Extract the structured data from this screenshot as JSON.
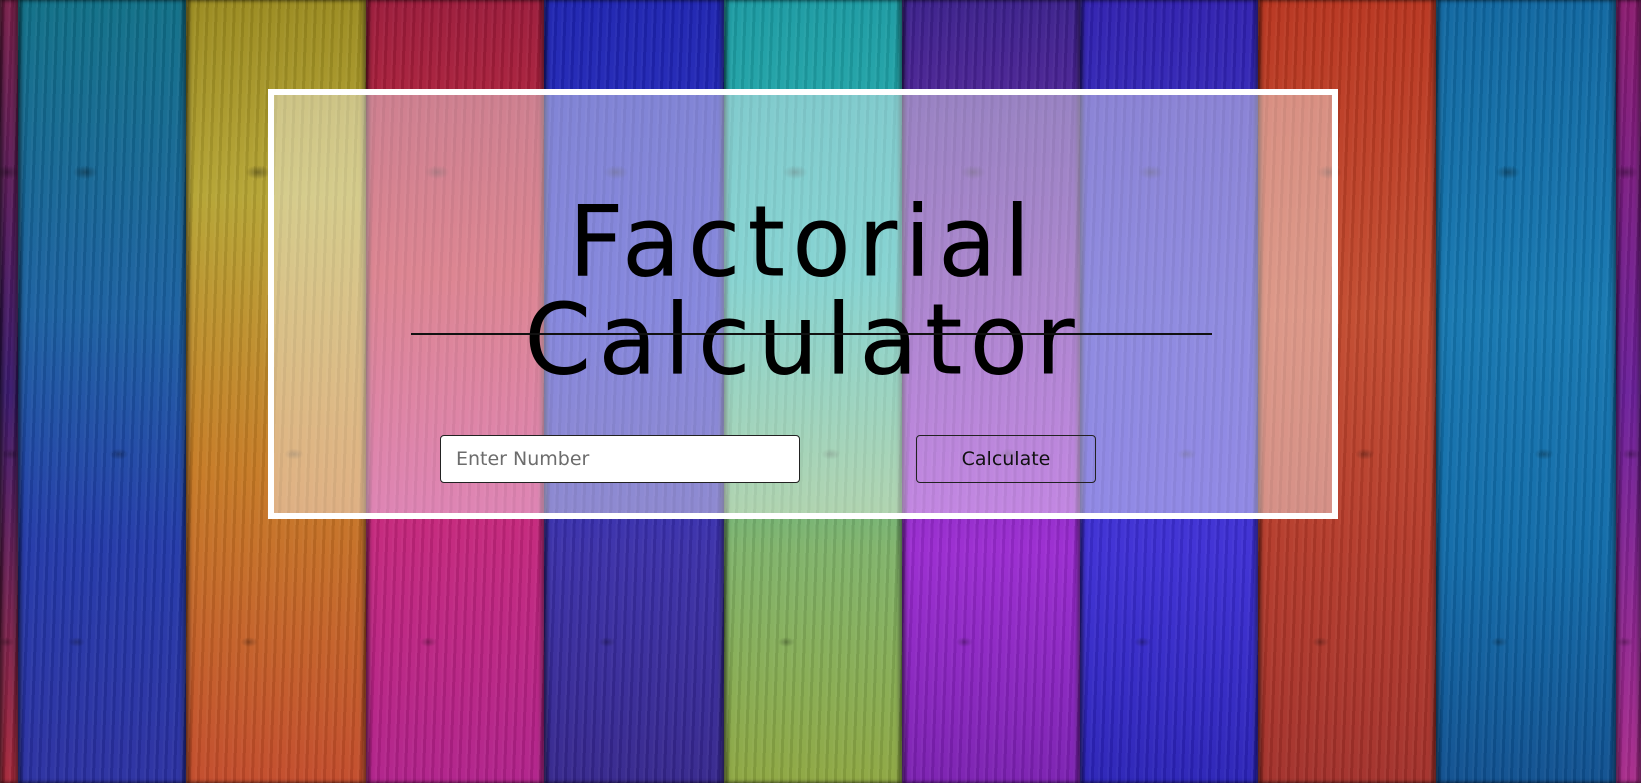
{
  "page": {
    "title": "Factorial Calculator"
  },
  "form": {
    "number_placeholder": "Enter Number",
    "number_value": "",
    "calculate_label": "Calculate"
  },
  "colors": {
    "panel_border": "#ffffff",
    "text": "#000000"
  }
}
